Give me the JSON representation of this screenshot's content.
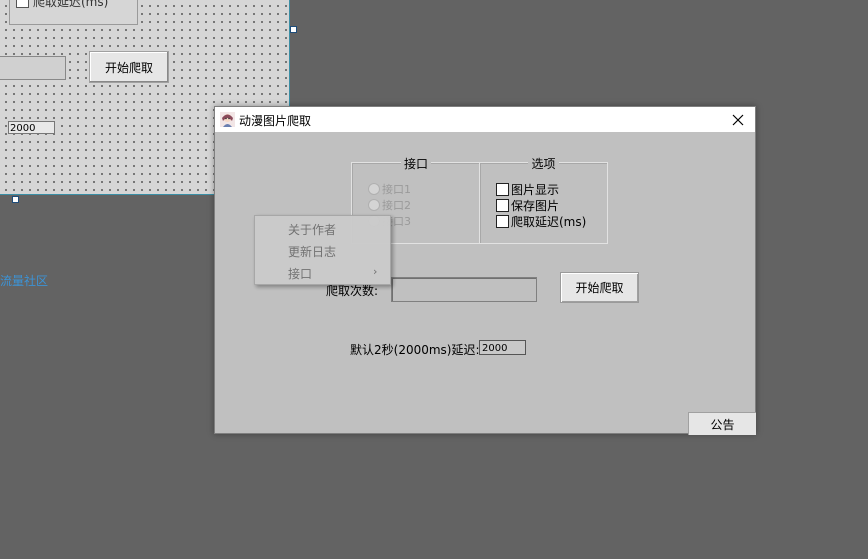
{
  "designer": {
    "checkbox_label": "爬取延迟(ms)",
    "button_label": "开始爬取",
    "delay_value": "2000"
  },
  "background_link": "流量社区",
  "window": {
    "title": "动漫图片爬取",
    "interface_group": {
      "title": "接口",
      "radios": [
        {
          "label": "接口1",
          "checked": false,
          "enabled": false
        },
        {
          "label": "接口2",
          "checked": false,
          "enabled": false
        },
        {
          "label": "接口3",
          "checked": false,
          "enabled": false
        }
      ]
    },
    "options_group": {
      "title": "选项",
      "checkboxes": [
        {
          "label": "图片显示",
          "checked": false
        },
        {
          "label": "保存图片",
          "checked": false
        },
        {
          "label": "爬取延迟(ms)",
          "checked": false
        }
      ]
    },
    "crawl_count_label": "爬取次数:",
    "crawl_count_value": "",
    "start_button": "开始爬取",
    "delay_label": "默认2秒(2000ms)延迟:",
    "delay_value": "2000",
    "notice_button": "公告"
  },
  "context_menu": {
    "items": [
      {
        "label": "关于作者",
        "has_submenu": false
      },
      {
        "label": "更新日志",
        "has_submenu": false
      },
      {
        "label": "接口",
        "has_submenu": true
      }
    ],
    "submenu_arrow": "›"
  },
  "colors": {
    "desktop": "#636363",
    "dialog_bg": "#c0c0c0",
    "link": "#3c93d6",
    "disabled_text": "#9a9a9a"
  }
}
